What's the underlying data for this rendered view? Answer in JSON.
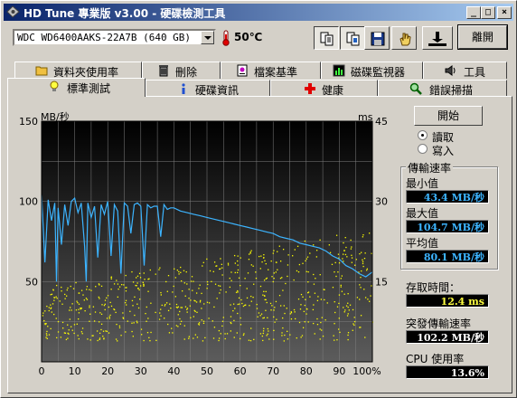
{
  "window": {
    "title": "HD Tune 專業版 v3.00 - 硬碟檢測工具",
    "controls": {
      "minimize": "_",
      "maximize": "□",
      "close": "×"
    }
  },
  "toolbar": {
    "drive": "WDC WD6400AAKS-22A7B  (640 GB)",
    "temperature": "50℃",
    "exit_label": "離開",
    "icons": [
      "copy-text-icon",
      "copy-screenshot-icon",
      "save-icon",
      "hand-options-icon",
      "disk-eject-icon"
    ]
  },
  "tabs": {
    "row1": [
      {
        "label": "資料夾使用率",
        "icon": "folder-icon"
      },
      {
        "label": "刪除",
        "icon": "trash-icon"
      },
      {
        "label": "檔案基準",
        "icon": "file-benchmark-icon"
      },
      {
        "label": "磁碟監視器",
        "icon": "monitor-chart-icon"
      },
      {
        "label": "工具",
        "icon": "speaker-icon"
      }
    ],
    "row2": [
      {
        "label": "標準測試",
        "icon": "lightbulb-icon",
        "selected": true
      },
      {
        "label": "硬碟資訊",
        "icon": "info-icon"
      },
      {
        "label": "健康",
        "icon": "health-cross-icon"
      },
      {
        "label": "錯誤掃描",
        "icon": "magnifier-icon"
      }
    ]
  },
  "controls": {
    "start_label": "開始",
    "mode_options": [
      {
        "label": "讀取",
        "selected": true
      },
      {
        "label": "寫入",
        "selected": false
      }
    ]
  },
  "stats": {
    "transfer_rate_title": "傳輸速率",
    "min_label": "最小值",
    "min_value": "43.4 MB/秒",
    "max_label": "最大值",
    "max_value": "104.7 MB/秒",
    "avg_label": "平均值",
    "avg_value": "80.1 MB/秒",
    "access_time_label": "存取時間：",
    "access_time_value": "12.4 ms",
    "burst_rate_label": "突發傳輸速率",
    "burst_rate_value": "102.2 MB/秒",
    "cpu_label": "CPU 使用率",
    "cpu_value": "13.6%"
  },
  "colors": {
    "transfer_line": "#3cb4ff",
    "access_points": "#ffff00",
    "chart_bg_top": "#000000",
    "chart_bg_bottom": "#606060",
    "grid": "#808080"
  },
  "chart_data": {
    "type": "line",
    "y_left_unit": "MB/秒",
    "y_right_unit": "ms",
    "x_ticks": [
      "0",
      "10",
      "20",
      "30",
      "40",
      "50",
      "60",
      "70",
      "80",
      "90",
      "100%"
    ],
    "y_left_ticks": [
      "150",
      "100",
      "50"
    ],
    "y_right_ticks": [
      "45",
      "30",
      "15"
    ],
    "xlim": [
      0,
      100
    ],
    "ylim_left": [
      0,
      150
    ],
    "ylim_right": [
      0,
      45
    ],
    "grid": true,
    "series": [
      {
        "kind": "transfer_rate",
        "x": [
          0,
          1,
          2,
          3,
          4,
          4.5,
          5,
          6,
          7,
          8,
          9,
          10,
          11,
          12,
          13,
          13.5,
          14,
          15,
          16,
          17,
          18,
          19,
          20,
          21,
          22,
          23,
          24,
          25,
          26,
          27,
          28,
          29,
          30,
          31,
          32,
          33,
          34,
          35,
          36,
          37,
          38,
          39,
          40,
          42,
          44,
          46,
          48,
          50,
          52,
          54,
          56,
          58,
          60,
          62,
          64,
          66,
          68,
          70,
          72,
          74,
          76,
          78,
          80,
          82,
          84,
          86,
          88,
          90,
          92,
          94,
          96,
          98,
          100
        ],
        "y": [
          104,
          62,
          101,
          88,
          99,
          50,
          96,
          73,
          98,
          85,
          100,
          102,
          93,
          99,
          72,
          50,
          99,
          90,
          97,
          65,
          98,
          92,
          100,
          66,
          98,
          94,
          55,
          99,
          97,
          80,
          98,
          99,
          97,
          60,
          98,
          96,
          97,
          97,
          78,
          98,
          95,
          96,
          96,
          94,
          93,
          92,
          91,
          90,
          89,
          88,
          87,
          86,
          85,
          84,
          83,
          82,
          81,
          80,
          78,
          77,
          76,
          74,
          73,
          72,
          71,
          69,
          66,
          64,
          60,
          58,
          55,
          53,
          56
        ]
      },
      {
        "kind": "access_time",
        "note": "scatter points in ms, range roughly 7–22 ms across the disk"
      }
    ]
  }
}
